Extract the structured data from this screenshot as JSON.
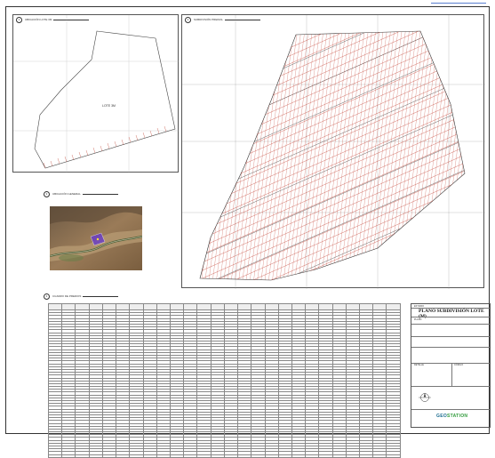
{
  "plan": {
    "title": "PLANO SUBDIVISIÓN LOTE (M)",
    "lot_label": "LOTE 3M",
    "colors": {
      "lines": "#c0392b",
      "grid": "#2d2d2d",
      "border": "#333333",
      "brand_blue": "#1a6b8f",
      "brand_green": "#2f9a3a"
    }
  },
  "panels": {
    "general": {
      "number": "1",
      "caption": "UBICACIÓN LOTE 3M"
    },
    "subdivision": {
      "number": "2",
      "caption": "SUBDIVISIÓN PREDIAL"
    },
    "location": {
      "number": "3",
      "caption": "UBICACIÓN GENERAL"
    },
    "table": {
      "number": "4",
      "caption": "CUADRO DE PREDIOS"
    }
  },
  "title_block": {
    "header": "ESTUDIO",
    "subtitle": "PLANO",
    "section_a": "DETALLE",
    "section_b": "CÓDIGO",
    "logo_left": "GEO",
    "logo_right": "STATION",
    "north_label": "N"
  },
  "table": {
    "columns": 26,
    "rows": 52
  }
}
